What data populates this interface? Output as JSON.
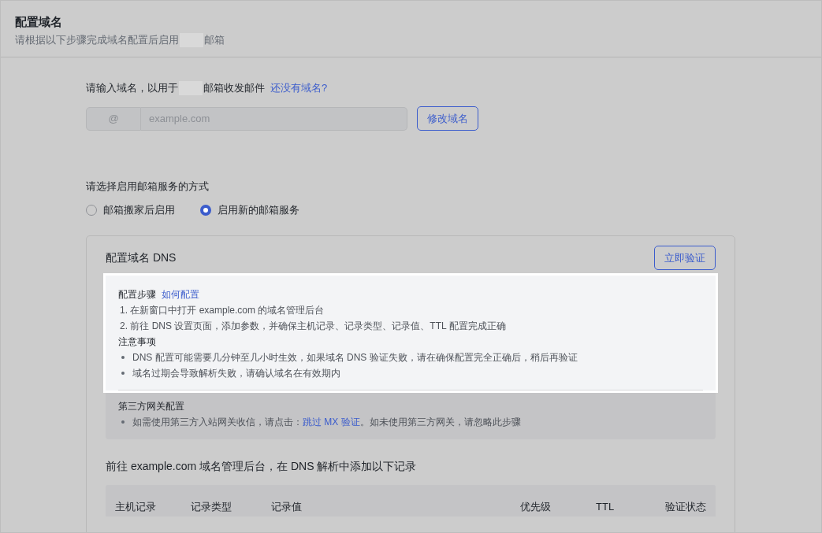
{
  "header": {
    "title": "配置域名",
    "subtitle_before": "请根据以下步骤完成域名配置后启用",
    "subtitle_after": "邮箱"
  },
  "domain": {
    "label_before": "请输入域名，以用于",
    "label_after": "邮箱收发邮件",
    "link": "还没有域名?",
    "prefix": "@",
    "placeholder": "example.com",
    "button": "修改域名"
  },
  "mode": {
    "label": "请选择启用邮箱服务的方式",
    "options": [
      {
        "label": "邮箱搬家后启用",
        "selected": false
      },
      {
        "label": "启用新的邮箱服务",
        "selected": true
      }
    ]
  },
  "dns_card": {
    "title": "配置域名 DNS",
    "verify_button": "立即验证",
    "steps_title": "配置步骤",
    "steps_link": "如何配置",
    "steps": [
      "1. 在新窗口中打开 example.com 的域名管理后台",
      "2. 前往 DNS 设置页面，添加参数，并确保主机记录、记录类型、记录值、TTL 配置完成正确"
    ],
    "notes_title": "注意事项",
    "notes": [
      "DNS 配置可能需要几分钟至几小时生效，如果域名 DNS 验证失败，请在确保配置完全正确后，稍后再验证",
      "域名过期会导致解析失败，请确认域名在有效期内"
    ],
    "gateway_title": "第三方网关配置",
    "gateway_before": "如需使用第三方入站网关收信，请点击：",
    "gateway_link": "跳过 MX 验证",
    "gateway_after": "。如未使用第三方网关，请忽略此步骤",
    "records_intro": "前往 example.com 域名管理后台，在 DNS 解析中添加以下记录",
    "columns": [
      "主机记录",
      "记录类型",
      "记录值",
      "优先级",
      "TTL",
      "验证状态"
    ]
  }
}
